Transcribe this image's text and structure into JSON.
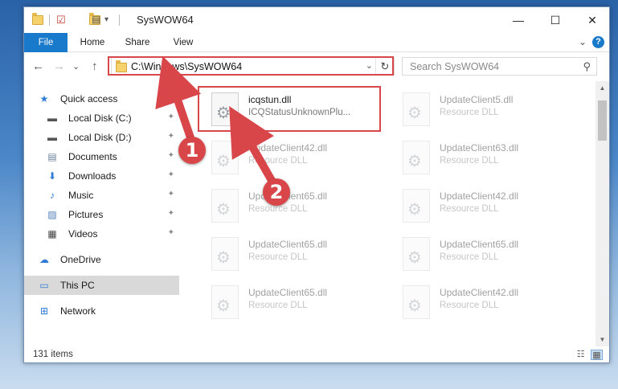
{
  "window": {
    "title": "SysWOW64",
    "minimize_glyph": "—",
    "maximize_glyph": "☐",
    "close_glyph": "✕"
  },
  "ribbon": {
    "tabs": [
      "File",
      "Home",
      "Share",
      "View"
    ],
    "expand_glyph": "⌄",
    "help_glyph": "?"
  },
  "navigation": {
    "back_glyph": "←",
    "forward_glyph": "→",
    "recent_glyph": "⌄",
    "up_glyph": "↑",
    "address": "C:\\Windows\\SysWOW64",
    "address_dropdown_glyph": "⌄",
    "refresh_glyph": "↻",
    "search_placeholder": "Search SysWOW64",
    "search_glyph": "⚲"
  },
  "sidebar": {
    "items": [
      {
        "label": "Quick access",
        "icon": "star-icon",
        "glyph": "★",
        "color": "#2e7ad6",
        "pinned": false
      },
      {
        "label": "Local Disk (C:)",
        "icon": "drive-icon",
        "glyph": "▬",
        "color": "#555555",
        "pinned": true
      },
      {
        "label": "Local Disk (D:)",
        "icon": "drive-icon",
        "glyph": "▬",
        "color": "#555555",
        "pinned": true
      },
      {
        "label": "Documents",
        "icon": "documents-icon",
        "glyph": "▤",
        "color": "#6a7f99",
        "pinned": true
      },
      {
        "label": "Downloads",
        "icon": "download-icon",
        "glyph": "⬇",
        "color": "#2e7ad6",
        "pinned": true
      },
      {
        "label": "Music",
        "icon": "music-icon",
        "glyph": "♪",
        "color": "#2e7ad6",
        "pinned": true
      },
      {
        "label": "Pictures",
        "icon": "pictures-icon",
        "glyph": "▨",
        "color": "#4d7fb8",
        "pinned": true
      },
      {
        "label": "Videos",
        "icon": "videos-icon",
        "glyph": "▦",
        "color": "#444444",
        "pinned": true
      },
      {
        "label": "OneDrive",
        "icon": "cloud-icon",
        "glyph": "☁",
        "color": "#2e7ad6",
        "pinned": false
      },
      {
        "label": "This PC",
        "icon": "computer-icon",
        "glyph": "▭",
        "color": "#2e7ad6",
        "pinned": false,
        "selected": true
      },
      {
        "label": "Network",
        "icon": "network-icon",
        "glyph": "⊞",
        "color": "#2e7ad6",
        "pinned": false
      }
    ],
    "pin_glyph": "📌"
  },
  "files": [
    {
      "name": "icqstun.dll",
      "type": "ICQStatusUnknownPlu...",
      "highlighted": true
    },
    {
      "name": "UpdateClient5.dll",
      "type": "Resource DLL"
    },
    {
      "name": "UpdateClient42.dll",
      "type": "Resource DLL"
    },
    {
      "name": "UpdateClient63.dll",
      "type": "Resource DLL"
    },
    {
      "name": "UpdateClient65.dll",
      "type": "Resource DLL"
    },
    {
      "name": "UpdateClient42.dll",
      "type": "Resource DLL"
    },
    {
      "name": "UpdateClient65.dll",
      "type": "Resource DLL"
    },
    {
      "name": "UpdateClient65.dll",
      "type": "Resource DLL"
    },
    {
      "name": "UpdateClient65.dll",
      "type": "Resource DLL"
    },
    {
      "name": "UpdateClient42.dll",
      "type": "Resource DLL"
    }
  ],
  "status": {
    "item_count": "131 items"
  },
  "annotations": [
    {
      "label": "1",
      "color": "#d9464a"
    },
    {
      "label": "2",
      "color": "#d9464a"
    }
  ]
}
